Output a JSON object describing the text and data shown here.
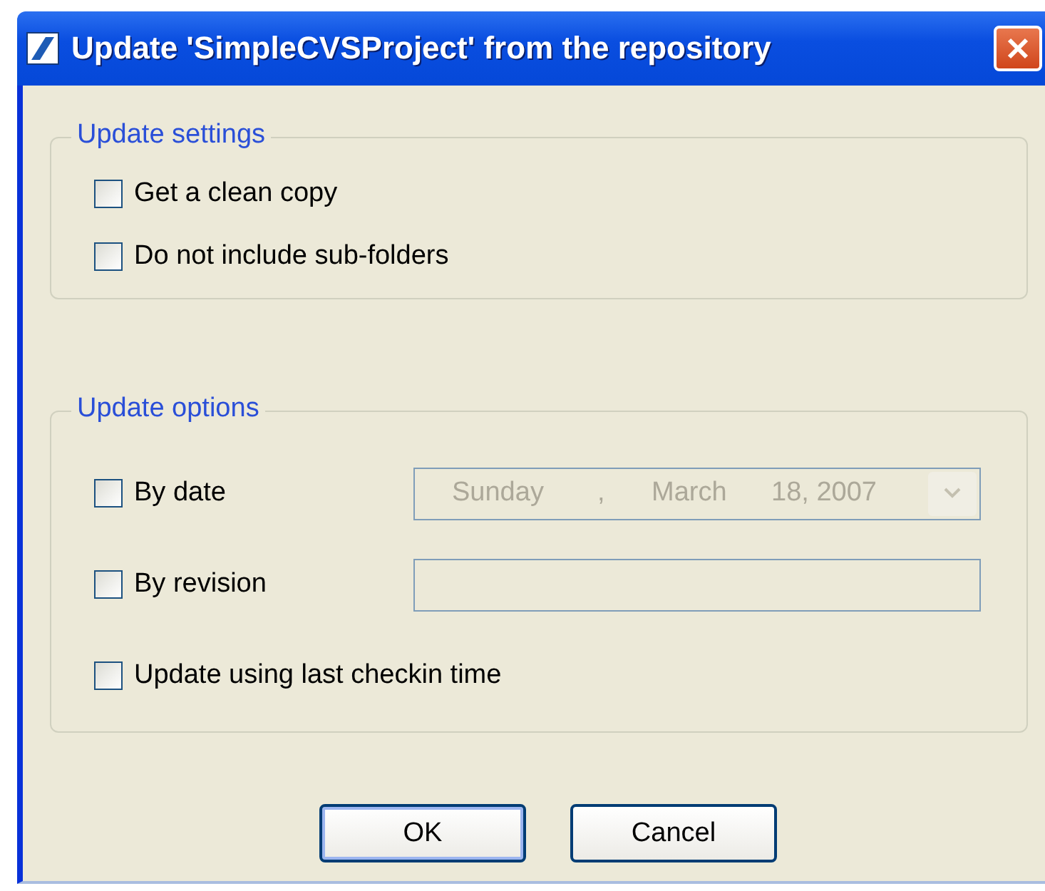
{
  "window": {
    "title": "Update 'SimpleCVSProject' from the repository"
  },
  "groups": [
    {
      "title": "Update settings",
      "rows": [
        {
          "kind": "checkbox",
          "label": "Get a clean copy",
          "checked": false
        },
        {
          "kind": "checkbox",
          "label": "Do not include sub-folders",
          "checked": false
        }
      ]
    },
    {
      "title": "Update options",
      "rows": [
        {
          "kind": "date",
          "label": "By date",
          "checked": false,
          "date": {
            "disabled": true,
            "parts": [
              "Sunday",
              ",",
              "March",
              "18, 2007"
            ]
          }
        },
        {
          "kind": "text",
          "label": "By revision",
          "checked": false,
          "field": {
            "disabled": true
          }
        },
        {
          "kind": "checkbox",
          "label": "Update using last checkin time",
          "checked": false
        }
      ]
    }
  ],
  "buttons": [
    {
      "label": "OK",
      "default": true
    },
    {
      "label": "Cancel",
      "default": false
    }
  ]
}
